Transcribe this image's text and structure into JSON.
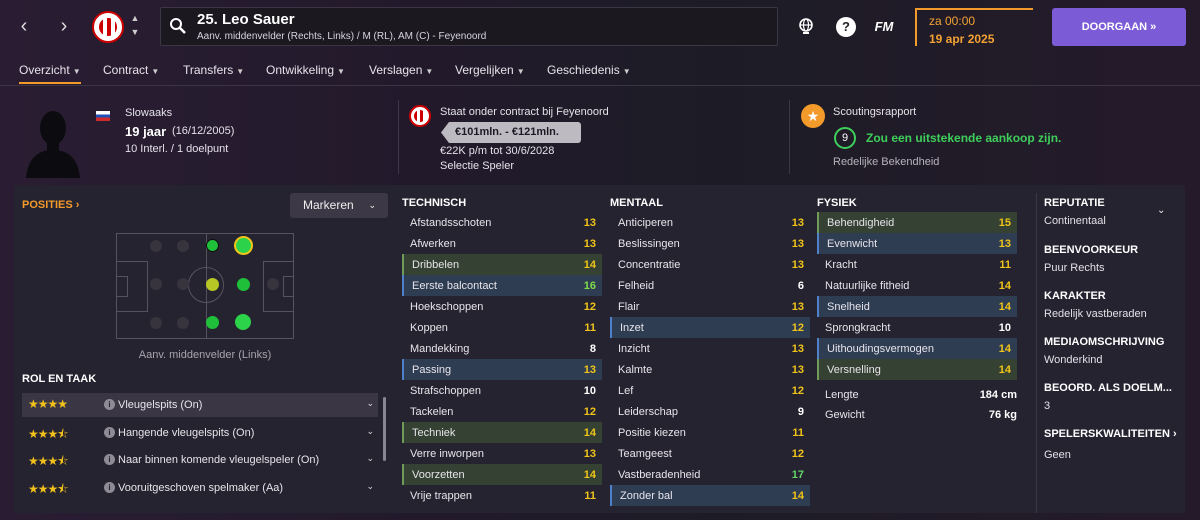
{
  "header": {
    "player_title": "25. Leo Sauer",
    "player_subtitle": "Aanv. middenvelder (Rechts, Links) / M (RL), AM (C) - Feyenoord",
    "fm_label": "FM",
    "help_label": "?",
    "date_time": "za 00:00",
    "date_day": "19 apr 2025",
    "continue_label": "DOORGAAN »"
  },
  "tabs": [
    "Overzicht",
    "Contract",
    "Transfers",
    "Ontwikkeling",
    "Verslagen",
    "Vergelijken",
    "Geschiedenis"
  ],
  "info": {
    "nationality": "Slowaaks",
    "age": "19 jaar",
    "birthdate": "(16/12/2005)",
    "caps": "10 Interl. / 1 doelpunt",
    "contract_title": "Staat onder contract bij Feyenoord",
    "value_range": "€101mln. - €121mln.",
    "wage": "€22K p/m tot 30/6/2028",
    "squad_status": "Selectie Speler",
    "scout_title": "Scoutingsrapport",
    "scout_score": "9",
    "scout_text": "Zou een uitstekende aankoop zijn.",
    "scout_knowledge": "Redelijke Bekendheid"
  },
  "positions": {
    "title": "POSITIES",
    "mark_label": "Markeren",
    "position_label": "Aanv. middenvelder (Links)"
  },
  "roles": {
    "title": "ROL EN TAAK",
    "items": [
      {
        "stars": "★★★★",
        "name": "Vleugelspits (On)"
      },
      {
        "stars": "★★★⯪",
        "name": "Hangende vleugelspits (On)"
      },
      {
        "stars": "★★★⯪",
        "name": "Naar binnen komende vleugelspeler (On)"
      },
      {
        "stars": "★★★⯪",
        "name": "Vooruitgeschoven spelmaker (Aa)"
      }
    ]
  },
  "technical": {
    "title": "TECHNISCH",
    "items": [
      {
        "name": "Afstandsschoten",
        "value": "13"
      },
      {
        "name": "Afwerken",
        "value": "13"
      },
      {
        "name": "Dribbelen",
        "value": "14"
      },
      {
        "name": "Eerste balcontact",
        "value": "16"
      },
      {
        "name": "Hoekschoppen",
        "value": "12"
      },
      {
        "name": "Koppen",
        "value": "11"
      },
      {
        "name": "Mandekking",
        "value": "8"
      },
      {
        "name": "Passing",
        "value": "13"
      },
      {
        "name": "Strafschoppen",
        "value": "10"
      },
      {
        "name": "Tackelen",
        "value": "12"
      },
      {
        "name": "Techniek",
        "value": "14"
      },
      {
        "name": "Verre inworpen",
        "value": "13"
      },
      {
        "name": "Voorzetten",
        "value": "14"
      },
      {
        "name": "Vrije trappen",
        "value": "11"
      }
    ]
  },
  "mental": {
    "title": "MENTAAL",
    "items": [
      {
        "name": "Anticiperen",
        "value": "13"
      },
      {
        "name": "Beslissingen",
        "value": "13"
      },
      {
        "name": "Concentratie",
        "value": "13"
      },
      {
        "name": "Felheid",
        "value": "6"
      },
      {
        "name": "Flair",
        "value": "13"
      },
      {
        "name": "Inzet",
        "value": "12"
      },
      {
        "name": "Inzicht",
        "value": "13"
      },
      {
        "name": "Kalmte",
        "value": "13"
      },
      {
        "name": "Lef",
        "value": "12"
      },
      {
        "name": "Leiderschap",
        "value": "9"
      },
      {
        "name": "Positie kiezen",
        "value": "11"
      },
      {
        "name": "Teamgeest",
        "value": "12"
      },
      {
        "name": "Vastberadenheid",
        "value": "17"
      },
      {
        "name": "Zonder bal",
        "value": "14"
      }
    ]
  },
  "physical": {
    "title": "FYSIEK",
    "items": [
      {
        "name": "Behendigheid",
        "value": "15"
      },
      {
        "name": "Evenwicht",
        "value": "13"
      },
      {
        "name": "Kracht",
        "value": "11"
      },
      {
        "name": "Natuurlijke fitheid",
        "value": "14"
      },
      {
        "name": "Snelheid",
        "value": "14"
      },
      {
        "name": "Sprongkracht",
        "value": "10"
      },
      {
        "name": "Uithoudingsvermogen",
        "value": "14"
      },
      {
        "name": "Versnelling",
        "value": "14"
      }
    ],
    "height_label": "Lengte",
    "height": "184 cm",
    "weight_label": "Gewicht",
    "weight": "76 kg"
  },
  "profile": [
    {
      "title": "REPUTATIE",
      "value": "Continentaal"
    },
    {
      "title": "BEENVOORKEUR",
      "value": "Puur Rechts"
    },
    {
      "title": "KARAKTER",
      "value": "Redelijk vastberaden"
    },
    {
      "title": "MEDIAOMSCHRIJVING",
      "value": "Wonderkind"
    },
    {
      "title": "BEOORD. ALS DOELM...",
      "value": "3"
    },
    {
      "title": "SPELERSKWALITEITEN",
      "value": "Geen"
    }
  ],
  "colors": {
    "accent": "#f39b2a",
    "primary_button": "#7b5cd6",
    "scout_good": "#3ecf5b"
  }
}
